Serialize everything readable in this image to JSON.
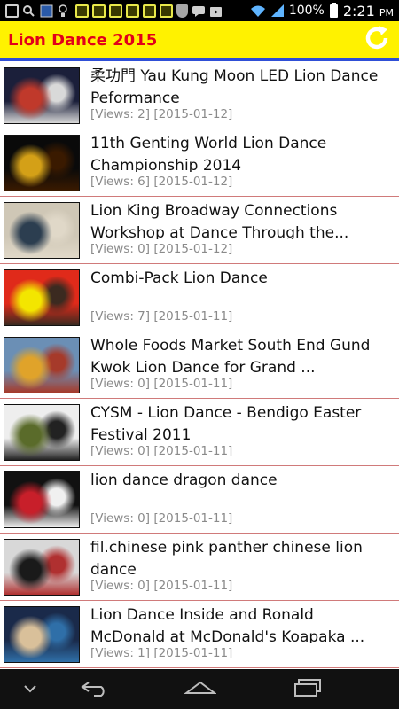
{
  "status_bar": {
    "battery": "100%",
    "time": "2:21",
    "ampm": "PM"
  },
  "app": {
    "title": "Lion Dance 2015",
    "refresh_icon": "refresh-icon"
  },
  "videos": [
    {
      "title": "柔功門 Yau Kung Moon LED Lion Dance Peformance",
      "meta": "[Views: 2] [2015-01-12]",
      "thumb_colors": [
        "#1b1f3a",
        "#c0392b",
        "#d9d9d9"
      ]
    },
    {
      "title": "11th Genting World Lion Dance Championship 2014",
      "meta": "[Views: 6] [2015-01-12]",
      "thumb_colors": [
        "#0a0a0a",
        "#d4a017",
        "#3a1a00"
      ]
    },
    {
      "title": "Lion King Broadway Connections Workshop at Dance Through the...",
      "meta": "[Views: 0] [2015-01-12]",
      "thumb_colors": [
        "#cfc7b6",
        "#2c3e50",
        "#e0d8c8"
      ]
    },
    {
      "title": "Combi-Pack Lion Dance",
      "meta": "[Views: 7] [2015-01-11]",
      "thumb_colors": [
        "#e02a1a",
        "#f3e600",
        "#3b2a20"
      ]
    },
    {
      "title": "Whole Foods Market South End Gund Kwok Lion Dance for Grand ...",
      "meta": "[Views: 0] [2015-01-11]",
      "thumb_colors": [
        "#6b8fb5",
        "#e0a32a",
        "#a63a2a"
      ]
    },
    {
      "title": "CYSM - Lion Dance -  Bendigo Easter Festival 2011",
      "meta": "[Views: 0] [2015-01-11]",
      "thumb_colors": [
        "#eeeeee",
        "#5a6b2a",
        "#222222"
      ]
    },
    {
      "title": "lion dance    dragon dance",
      "meta": "[Views: 0] [2015-01-11]",
      "thumb_colors": [
        "#111111",
        "#c81f2a",
        "#f0f0f0"
      ]
    },
    {
      "title": "fil.chinese pink panther chinese lion dance",
      "meta": "[Views: 0] [2015-01-11]",
      "thumb_colors": [
        "#d8d8d8",
        "#1a1a1a",
        "#b03030"
      ]
    },
    {
      "title": "Lion Dance Inside and Ronald McDonald at McDonald's Koapaka ...",
      "meta": "[Views: 1] [2015-01-11]",
      "thumb_colors": [
        "#1a2a4a",
        "#d9c09a",
        "#2f6fa8"
      ]
    }
  ],
  "nav_bar": {
    "icons": [
      "chevron-down-icon",
      "back-icon",
      "home-icon",
      "recent-apps-icon"
    ]
  }
}
